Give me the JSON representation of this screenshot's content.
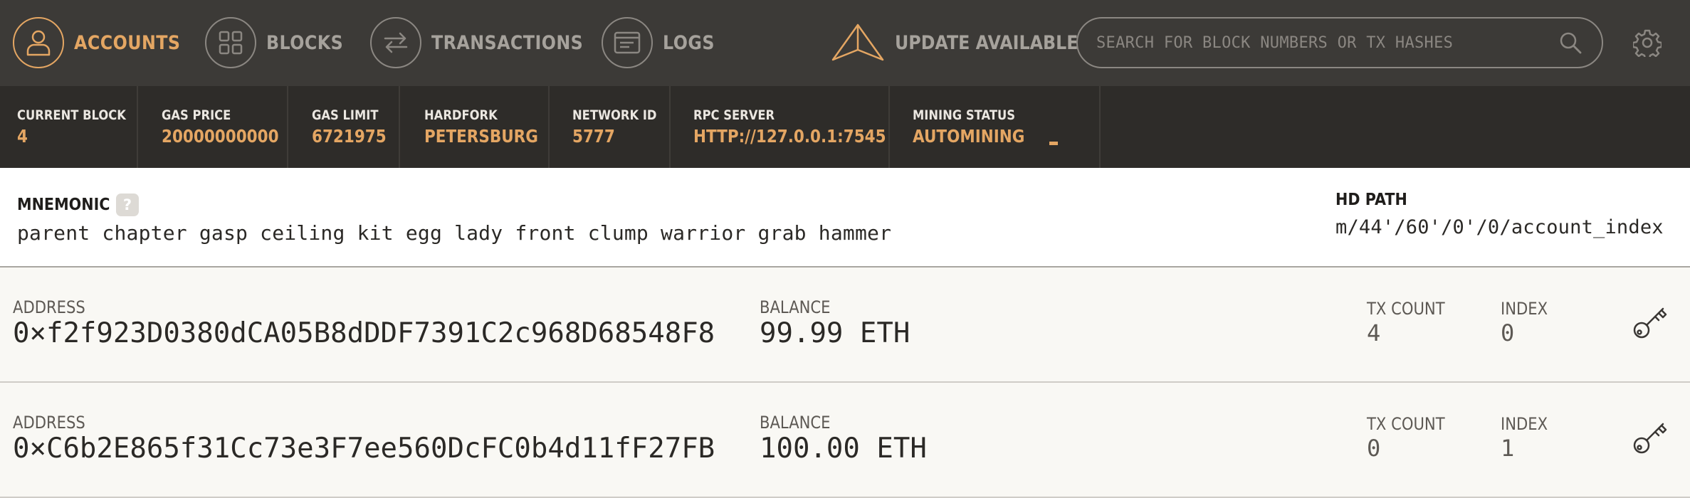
{
  "nav": {
    "items": [
      {
        "label": "ACCOUNTS",
        "icon": "account-icon",
        "active": true
      },
      {
        "label": "BLOCKS",
        "icon": "blocks-icon",
        "active": false
      },
      {
        "label": "TRANSACTIONS",
        "icon": "transactions-icon",
        "active": false
      },
      {
        "label": "LOGS",
        "icon": "logs-icon",
        "active": false
      }
    ],
    "update_label": "UPDATE AVAILABLE",
    "search_placeholder": "SEARCH FOR BLOCK NUMBERS OR TX HASHES"
  },
  "status": [
    {
      "label": "CURRENT BLOCK",
      "value": "4"
    },
    {
      "label": "GAS PRICE",
      "value": "20000000000"
    },
    {
      "label": "GAS LIMIT",
      "value": "6721975"
    },
    {
      "label": "HARDFORK",
      "value": "PETERSBURG"
    },
    {
      "label": "NETWORK ID",
      "value": "5777"
    },
    {
      "label": "RPC SERVER",
      "value": "HTTP://127.0.0.1:7545"
    },
    {
      "label": "MINING STATUS",
      "value": "AUTOMINING"
    }
  ],
  "mnemonic": {
    "label": "MNEMONIC",
    "help": "?",
    "phrase": "parent chapter gasp ceiling kit egg lady front clump warrior grab hammer",
    "hd_path_label": "HD PATH",
    "hd_path": "m/44'/60'/0'/0/account_index"
  },
  "accounts": {
    "labels": {
      "address": "ADDRESS",
      "balance": "BALANCE",
      "tx_count": "TX COUNT",
      "index": "INDEX"
    },
    "rows": [
      {
        "address": "0×f2f923D0380dCA05B8dDDF7391C2c968D68548F8",
        "balance": "99.99 ETH",
        "tx_count": "4",
        "index": "0"
      },
      {
        "address": "0×C6b2E865f31Cc73e3F7ee560DcFC0b4d11fF27FB",
        "balance": "100.00 ETH",
        "tx_count": "0",
        "index": "1"
      }
    ]
  },
  "colors": {
    "accent": "#e4a663",
    "nav_bg": "#3c3a37",
    "status_bg": "#2e2c29",
    "row_bg": "#f9f8f4"
  }
}
